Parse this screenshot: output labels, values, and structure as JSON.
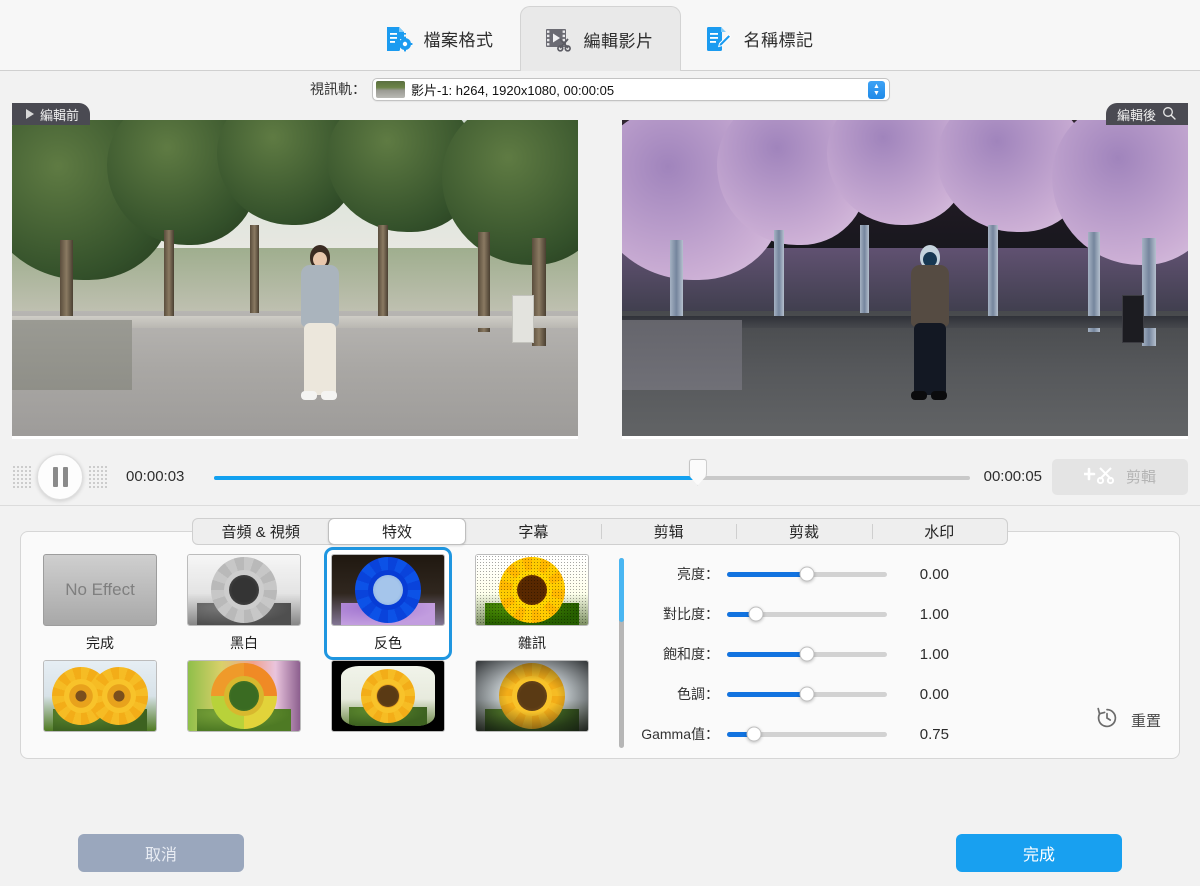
{
  "topbar": {
    "tabs": [
      {
        "label": "檔案格式",
        "icon": "file-format-icon",
        "active": false
      },
      {
        "label": "編輯影片",
        "icon": "edit-video-icon",
        "active": true
      },
      {
        "label": "名稱標記",
        "icon": "name-tag-icon",
        "active": false
      }
    ]
  },
  "track": {
    "label": "視訊軌：",
    "value": "影片-1: h264, 1920x1080, 00:00:05",
    "stepper_icon": "stepper-updown-icon"
  },
  "preview": {
    "before_label": "編輯前",
    "after_label": "編輯後",
    "play_icon": "play-triangle-icon",
    "search_icon": "magnifier-icon"
  },
  "transport": {
    "pause_icon": "pause-icon",
    "current_time": "00:00:03",
    "total_time": "00:00:05",
    "progress_percent": 64,
    "cut_label": "剪輯",
    "cut_icon": "add-scissors-icon"
  },
  "segments": [
    {
      "label": "音頻 & 視頻",
      "active": false
    },
    {
      "label": "特效",
      "active": true
    },
    {
      "label": "字幕",
      "active": false
    },
    {
      "label": "剪辑",
      "active": false
    },
    {
      "label": "剪裁",
      "active": false
    },
    {
      "label": "水印",
      "active": false
    }
  ],
  "effects": [
    {
      "label": "完成",
      "kind": "none",
      "selected": false
    },
    {
      "label": "黑白",
      "kind": "grayscale",
      "selected": false
    },
    {
      "label": "反色",
      "kind": "invert",
      "selected": true
    },
    {
      "label": "雜訊",
      "kind": "noise",
      "selected": false
    },
    {
      "label": "",
      "kind": "mirror",
      "selected": false
    },
    {
      "label": "",
      "kind": "rainbow",
      "selected": false
    },
    {
      "label": "",
      "kind": "tv",
      "selected": false
    },
    {
      "label": "",
      "kind": "vignette",
      "selected": false
    }
  ],
  "sliders": [
    {
      "label": "亮度：",
      "value": "0.00",
      "percent": 50
    },
    {
      "label": "對比度：",
      "value": "1.00",
      "percent": 18
    },
    {
      "label": "飽和度：",
      "value": "1.00",
      "percent": 50
    },
    {
      "label": "色調：",
      "value": "0.00",
      "percent": 50
    },
    {
      "label": "Gamma值：",
      "value": "0.75",
      "percent": 17
    }
  ],
  "reset": {
    "label": "重置",
    "icon": "reset-clock-icon"
  },
  "footer": {
    "cancel_label": "取消",
    "done_label": "完成"
  },
  "colors": {
    "accent_blue": "#18a0f0",
    "slider_blue": "#1273e0",
    "selection_blue": "#1f96e0",
    "cancel_gray": "#9aa7bd"
  }
}
